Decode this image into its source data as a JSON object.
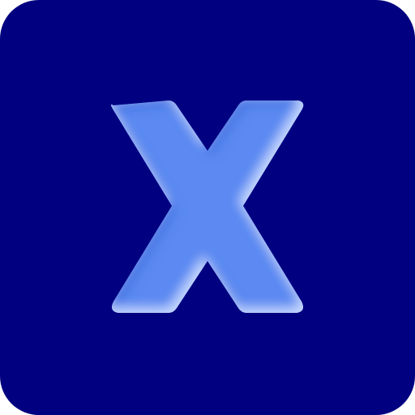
{
  "icon": {
    "name": "x-app-icon",
    "glyph": "X",
    "colors": {
      "background": "#000080",
      "glyph_fill": "#5b8af2",
      "glyph_highlight": "#c9dcff",
      "glyph_shade": "#3f6fe0"
    }
  }
}
